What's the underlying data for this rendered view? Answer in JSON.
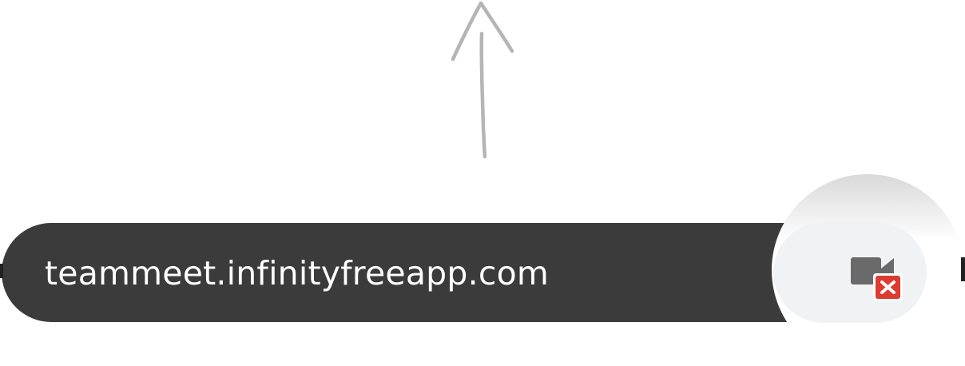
{
  "address_bar": {
    "url": "teammeet.infinityfreeapp.com"
  },
  "camera_indicator": {
    "icon": "camera-blocked-icon",
    "status": "blocked",
    "accent_color": "#dd3b30"
  },
  "hint_arrow": {
    "icon": "up-arrow-icon",
    "color": "#b5b5b5"
  },
  "colors": {
    "bar_background": "#3b3b3b",
    "button_background": "#f1f2f4",
    "text": "#ffffff"
  }
}
